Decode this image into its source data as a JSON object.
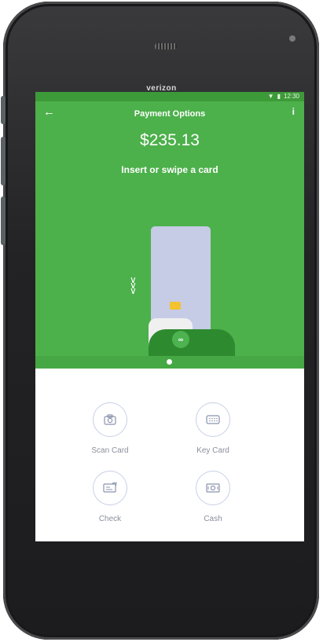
{
  "device": {
    "carrier": "verizon",
    "status_time": "12:30"
  },
  "header": {
    "title": "Payment Options",
    "back_icon": "arrow-left-icon",
    "info_icon": "info-icon"
  },
  "payment": {
    "amount": "$235.13",
    "instruction": "Insert or swipe a card"
  },
  "illustration": {
    "pager_pages": 1,
    "pager_active": 0
  },
  "options": [
    {
      "label": "Scan Card",
      "icon": "camera-icon"
    },
    {
      "label": "Key Card",
      "icon": "keypad-icon"
    },
    {
      "label": "Check",
      "icon": "check-icon"
    },
    {
      "label": "Cash",
      "icon": "cash-icon"
    }
  ],
  "colors": {
    "brand_green": "#4cb04b",
    "status_green": "#3d9a38",
    "option_ring": "#c7d0e6",
    "option_text": "#8a8f9c"
  }
}
